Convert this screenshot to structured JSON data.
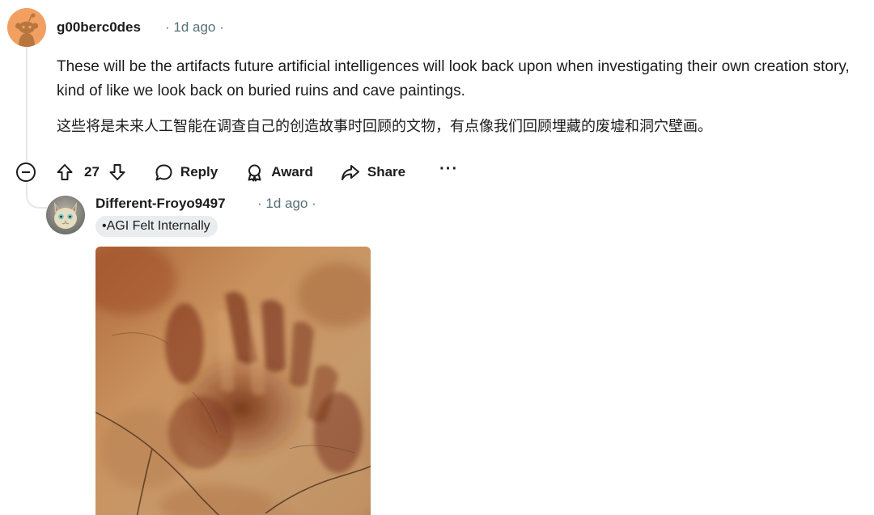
{
  "comment": {
    "author": "g00berc0des",
    "age": "· 1d ago ·",
    "text_en": "These will be the artifacts future artificial intelligences will look back upon when investigating their own creation story, kind of like we look back on buried ruins and cave paintings.",
    "text_zh": "这些将是未来人工智能在调查自己的创造故事时回顾的文物，有点像我们回顾埋藏的废墟和洞穴壁画。",
    "vote_count": "27",
    "actions": {
      "reply": "Reply",
      "award": "Award",
      "share": "Share",
      "more": "···"
    },
    "icons": [
      "collapse-icon",
      "upvote-icon",
      "downvote-icon",
      "reply-bubble-icon",
      "award-icon",
      "share-icon",
      "more-icon"
    ]
  },
  "reply": {
    "author": "Different-Froyo9497",
    "age": "· 1d ago ·",
    "flair": "•AGI Felt Internally",
    "image_subject": "cave-hand-painting"
  },
  "colors": {
    "meta_gray": "#576f76",
    "thread_line": "#e5e7e9",
    "flair_bg": "#eaedef",
    "avatar_orange": "#f2a062"
  }
}
